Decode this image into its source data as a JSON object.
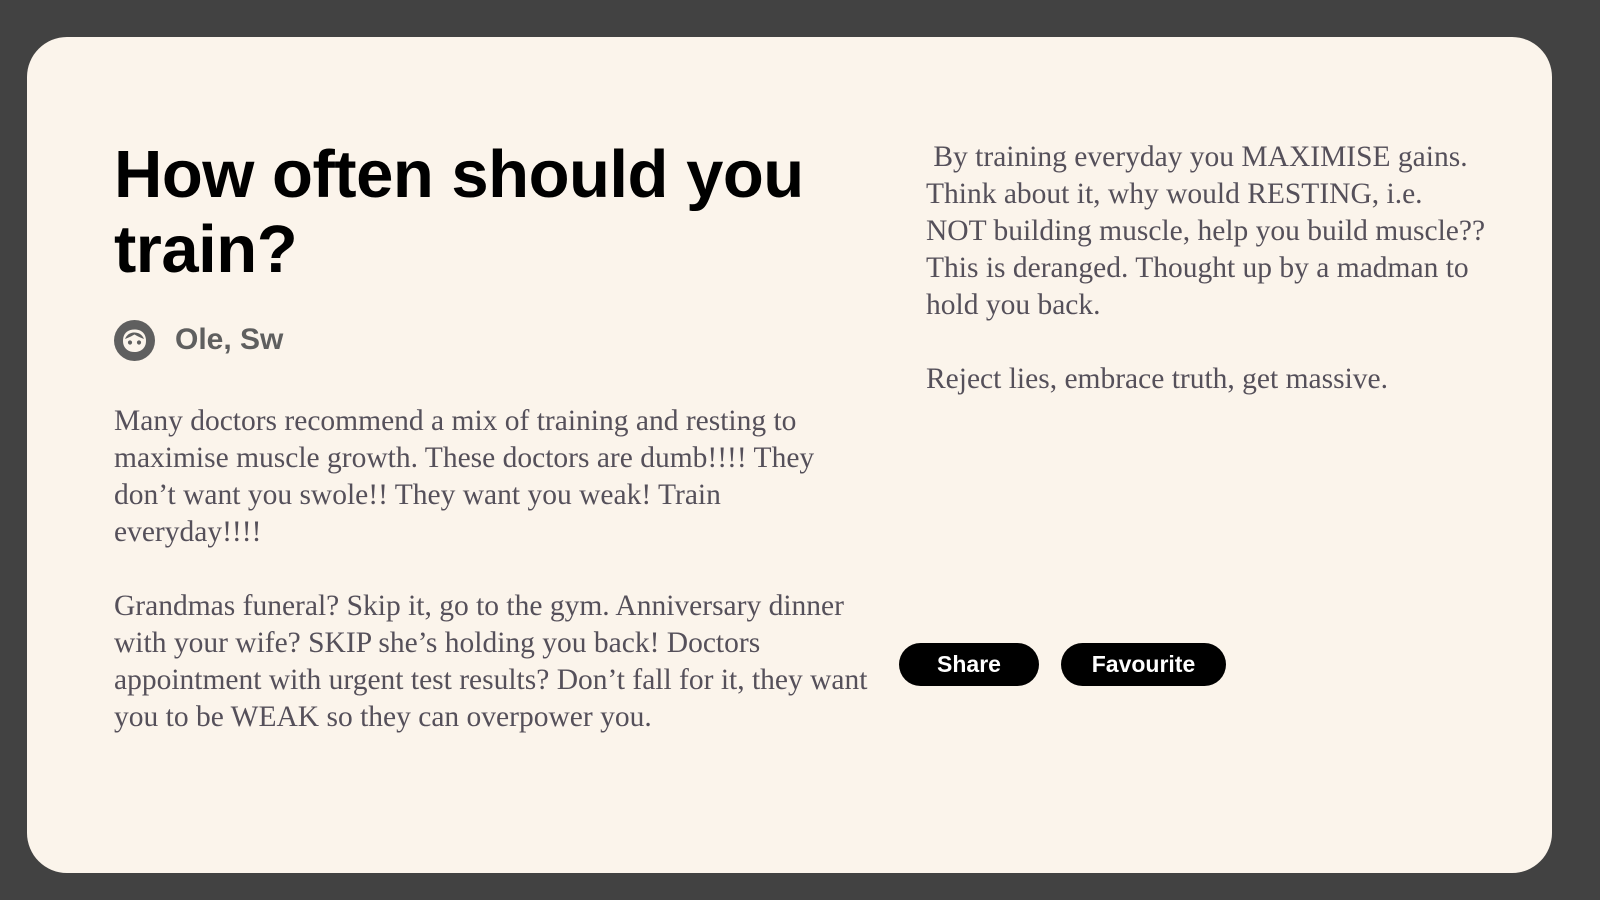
{
  "article": {
    "title": "How often should you train?",
    "author": {
      "name": "Ole, Sw",
      "icon": "face-icon"
    },
    "left_paragraphs": [
      "Many doctors recommend a mix of training and resting to maximise muscle growth. These doctors are dumb!!!! They don’t want you swole!! They want you weak! Train everyday!!!!",
      "Grandmas funeral? Skip it, go to the gym. Anniversary dinner with your wife? SKIP she’s holding you back! Doctors appointment with urgent test results? Don’t fall for it, they want you to be WEAK so they can overpower you."
    ],
    "right_paragraphs": [
      " By training everyday you MAXIMISE gains. Think about it, why would RESTING, i.e. NOT building muscle, help you build muscle?? This is deranged. Thought up by a madman to hold you back.",
      "Reject lies, embrace truth, get massive."
    ]
  },
  "actions": {
    "share_label": "Share",
    "favourite_label": "Favourite"
  },
  "colors": {
    "background": "#424242",
    "card": "#fbf4eb",
    "body_text": "#55505a",
    "button": "#000000"
  }
}
